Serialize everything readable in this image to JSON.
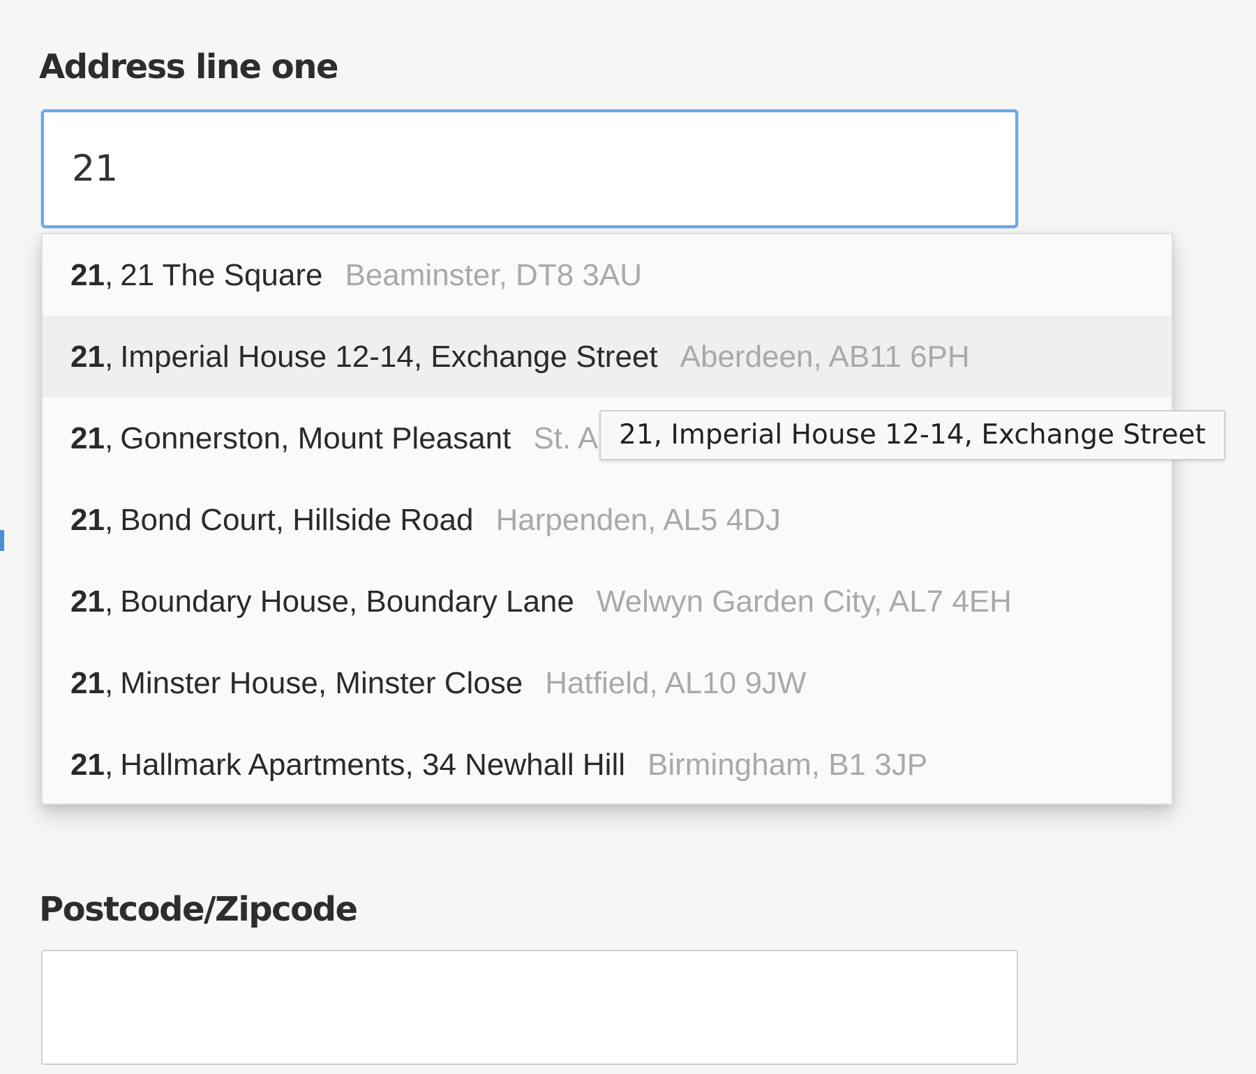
{
  "address_field": {
    "label": "Address line one",
    "value": "21"
  },
  "postcode_field": {
    "label": "Postcode/Zipcode",
    "value": ""
  },
  "suggestions": [
    {
      "number": "21",
      "street": "21 The Square",
      "locality": "Beaminster, DT8 3AU"
    },
    {
      "number": "21",
      "street": "Imperial House 12-14, Exchange Street",
      "locality": "Aberdeen, AB11 6PH"
    },
    {
      "number": "21",
      "street": "Gonnerston, Mount Pleasant",
      "locality": "St. A"
    },
    {
      "number": "21",
      "street": "Bond Court, Hillside Road",
      "locality": "Harpenden, AL5 4DJ"
    },
    {
      "number": "21",
      "street": "Boundary House, Boundary Lane",
      "locality": "Welwyn Garden City, AL7 4EH"
    },
    {
      "number": "21",
      "street": "Minster House, Minster Close",
      "locality": "Hatfield, AL10 9JW"
    },
    {
      "number": "21",
      "street": "Hallmark Apartments, 34 Newhall Hill",
      "locality": "Birmingham, B1 3JP"
    }
  ],
  "highlighted_index": 1,
  "tooltip": {
    "text": "21, Imperial House 12-14, Exchange Street"
  },
  "colors": {
    "focus_border": "#6aa9ea",
    "highlight_row": "#efefef",
    "locality_text": "#a9a9a9"
  }
}
